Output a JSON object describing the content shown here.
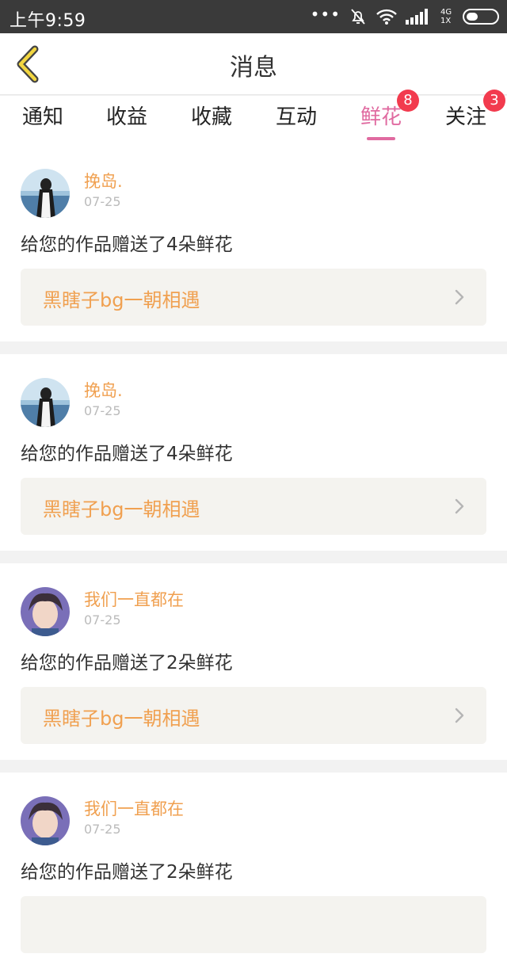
{
  "status_bar": {
    "time": "上午9:59",
    "network": "4G",
    "signal_sub": "1X"
  },
  "header": {
    "title": "消息"
  },
  "tabs": [
    {
      "label": "通知",
      "badge": ""
    },
    {
      "label": "收益",
      "badge": ""
    },
    {
      "label": "收藏",
      "badge": ""
    },
    {
      "label": "互动",
      "badge": ""
    },
    {
      "label": "鲜花",
      "badge": "8"
    },
    {
      "label": "关注",
      "badge": "3"
    }
  ],
  "active_tab": "鲜花",
  "accent_color": "#e06aa0",
  "badge_color": "#f23b4e",
  "messages": [
    {
      "user": "挽岛.",
      "date": "07-25",
      "text": "给您的作品赠送了4朵鲜花",
      "work": "黑瞎子bg一朝相遇"
    },
    {
      "user": "挽岛.",
      "date": "07-25",
      "text": "给您的作品赠送了4朵鲜花",
      "work": "黑瞎子bg一朝相遇"
    },
    {
      "user": "我们一直都在",
      "date": "07-25",
      "text": "给您的作品赠送了2朵鲜花",
      "work": "黑瞎子bg一朝相遇"
    },
    {
      "user": "我们一直都在",
      "date": "07-25",
      "text": "给您的作品赠送了2朵鲜花",
      "work": ""
    }
  ]
}
